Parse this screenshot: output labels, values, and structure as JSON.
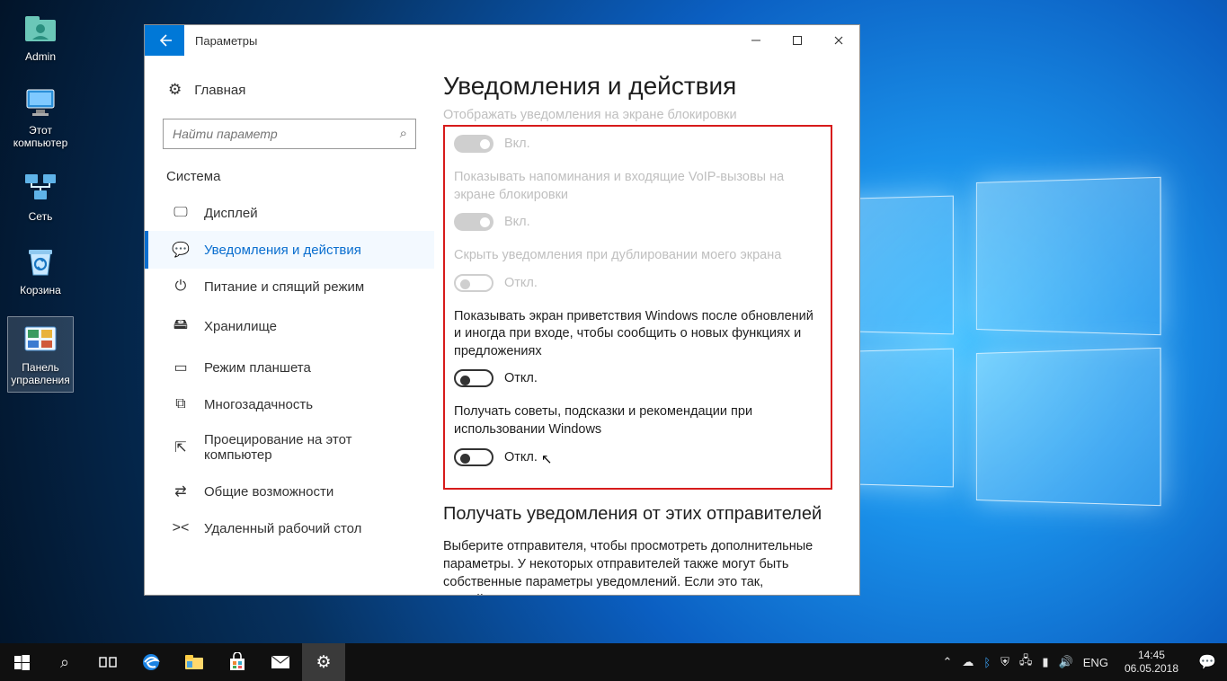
{
  "desktop": {
    "icons": [
      {
        "label": "Admin"
      },
      {
        "label": "Этот компьютер"
      },
      {
        "label": "Сеть"
      },
      {
        "label": "Корзина"
      },
      {
        "label": "Панель управления"
      }
    ]
  },
  "window": {
    "title": "Параметры",
    "home": "Главная",
    "search_placeholder": "Найти параметр",
    "group": "Система",
    "nav": [
      {
        "label": "Дисплей"
      },
      {
        "label": "Уведомления и действия"
      },
      {
        "label": "Питание и спящий режим"
      },
      {
        "label": "Хранилище"
      },
      {
        "label": "Режим планшета"
      },
      {
        "label": "Многозадачность"
      },
      {
        "label": "Проецирование на этот компьютер"
      },
      {
        "label": "Общие возможности"
      },
      {
        "label": "Удаленный рабочий стол"
      }
    ],
    "heading": "Уведомления и действия",
    "cut_option": "Отображать уведомления на экране блокировки",
    "options": [
      {
        "label": "",
        "state": "Вкл.",
        "disabled": true,
        "on": true
      },
      {
        "label": "Показывать напоминания и входящие VoIP-вызовы на экране блокировки",
        "state": "Вкл.",
        "disabled": true,
        "on": true
      },
      {
        "label": "Скрыть уведомления при дублировании моего экрана",
        "state": "Откл.",
        "disabled": true,
        "on": false
      },
      {
        "label": "Показывать экран приветствия Windows после обновлений и иногда при входе, чтобы сообщить о новых функциях и предложениях",
        "state": "Откл.",
        "disabled": false,
        "on": false
      },
      {
        "label": "Получать советы, подсказки и рекомендации при использовании Windows",
        "state": "Откл.",
        "disabled": false,
        "on": false,
        "cursor": true
      }
    ],
    "subheading": "Получать уведомления от этих отправителей",
    "subtext": "Выберите отправителя, чтобы просмотреть дополнительные параметры. У некоторых отправителей также могут быть собственные параметры уведомлений. Если это так, откройте"
  },
  "taskbar": {
    "tray_lang": "ENG",
    "time": "14:45",
    "date": "06.05.2018"
  }
}
